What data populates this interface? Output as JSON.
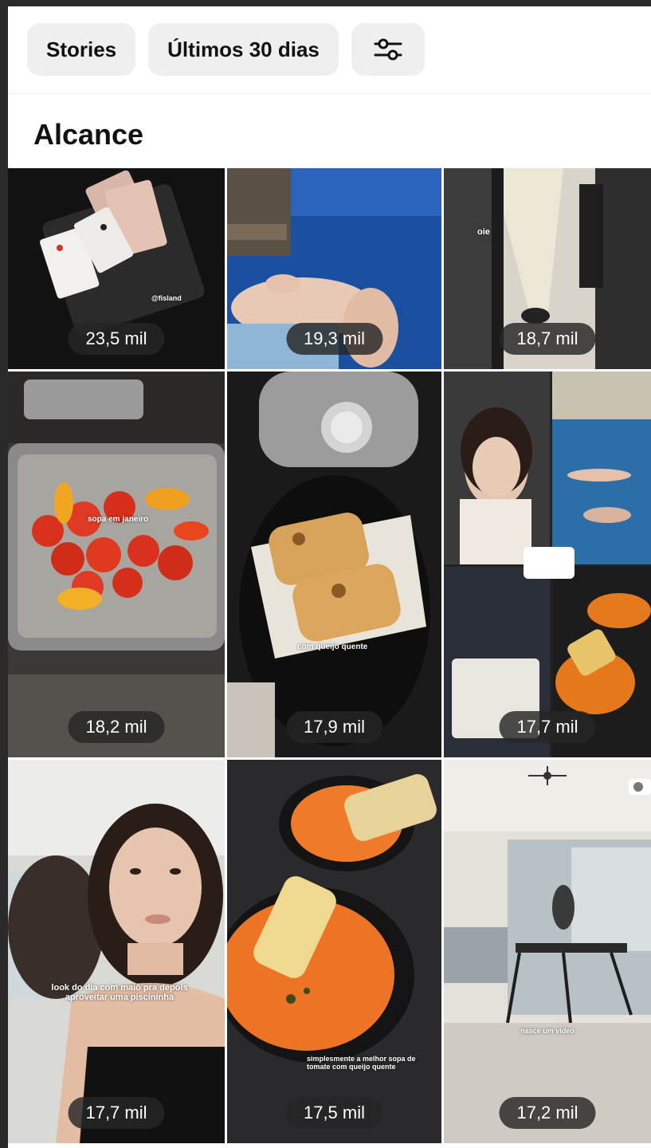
{
  "filters": {
    "stories_label": "Stories",
    "period_label": "Últimos 30 dias",
    "settings_icon": "sliders-icon"
  },
  "section": {
    "title": "Alcance"
  },
  "posts": [
    {
      "reach": "23,5 mil",
      "caption": "@fisland"
    },
    {
      "reach": "19,3 mil",
      "caption": ""
    },
    {
      "reach": "18,7 mil",
      "caption": "oie"
    },
    {
      "reach": "18,2 mil",
      "caption": "sopa em janeiro"
    },
    {
      "reach": "17,9 mil",
      "caption": "com queijo quente"
    },
    {
      "reach": "17,7 mil",
      "caption": ""
    },
    {
      "reach": "17,7 mil",
      "caption": "look do dia com maiô pra depois aproveitar uma piscininha"
    },
    {
      "reach": "17,5 mil",
      "caption": "simplesmente a melhor sopa de tomate com queijo quente"
    },
    {
      "reach": "17,2 mil",
      "caption": "nasce um vídeo"
    }
  ],
  "colors": {
    "chip_bg": "#efefef",
    "badge_bg": "#262626"
  }
}
